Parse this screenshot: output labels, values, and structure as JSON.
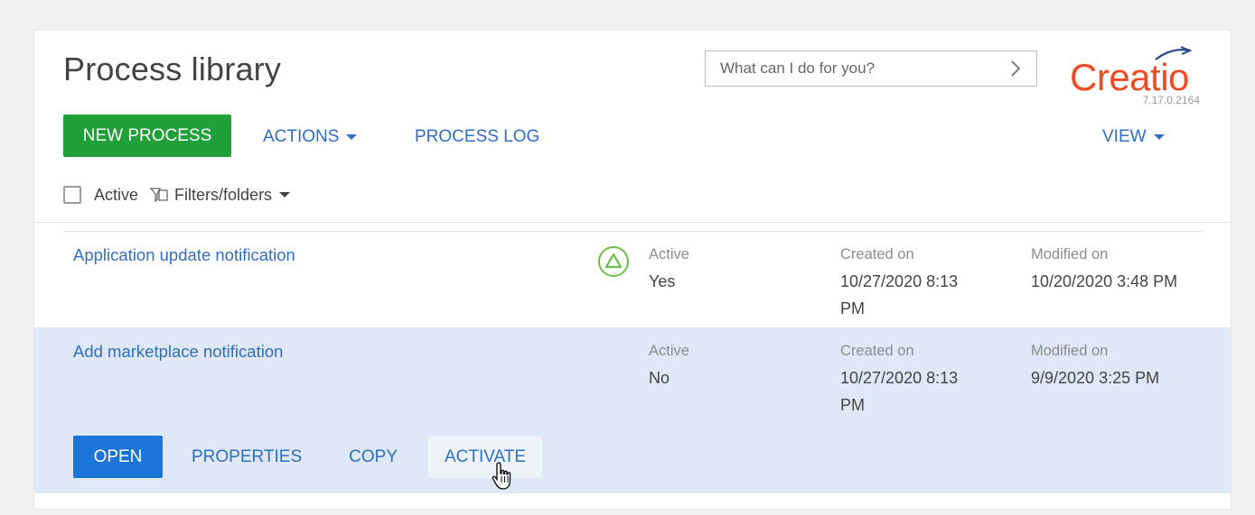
{
  "header": {
    "title": "Process library",
    "search_placeholder": "What can I do for you?",
    "logo_text": "Creatio",
    "version": "7.17.0.2164"
  },
  "toolbar": {
    "new_process_label": "NEW PROCESS",
    "actions_label": "ACTIONS",
    "process_log_label": "PROCESS LOG",
    "view_label": "VIEW"
  },
  "filters": {
    "active_label": "Active",
    "active_checked": false,
    "filters_folders_label": "Filters/folders"
  },
  "rows": [
    {
      "name": "Application update notification",
      "active_label": "Active",
      "active_value": "Yes",
      "status_icon": "active-triangle-icon",
      "created_label": "Created on",
      "created_value_line1": "10/27/2020 8:13",
      "created_value_line2": "PM",
      "modified_label": "Modified on",
      "modified_value": "10/20/2020 3:48 PM"
    },
    {
      "name": "Add marketplace notification",
      "active_label": "Active",
      "active_value": "No",
      "created_label": "Created on",
      "created_value_line1": "10/27/2020 8:13",
      "created_value_line2": "PM",
      "modified_label": "Modified on",
      "modified_value": "9/9/2020 3:25 PM",
      "actions": {
        "open_label": "OPEN",
        "properties_label": "PROPERTIES",
        "copy_label": "COPY",
        "activate_label": "ACTIVATE"
      }
    }
  ],
  "colors": {
    "brand": "#f04c23",
    "primary_green": "#1fa038",
    "primary_blue": "#1b74d8",
    "link": "#2f6ec4",
    "selected_row": "#dfe8f6",
    "status_green": "#6cc04a"
  }
}
